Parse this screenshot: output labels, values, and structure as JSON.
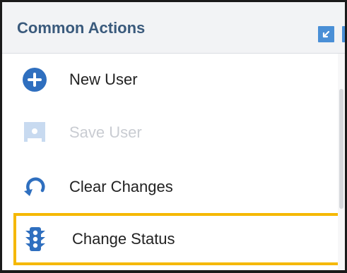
{
  "panel": {
    "title": "Common Actions",
    "header_buttons": [
      {
        "icon": "collapse-icon"
      },
      {
        "icon": "expand-icon"
      }
    ]
  },
  "actions": [
    {
      "label": "New User",
      "icon": "plus-circle-icon",
      "enabled": true
    },
    {
      "label": "Save User",
      "icon": "save-icon",
      "enabled": false
    },
    {
      "label": "Clear Changes",
      "icon": "undo-icon",
      "enabled": true
    },
    {
      "label": "Change Status",
      "icon": "traffic-light-icon",
      "enabled": true,
      "highlighted": true
    }
  ],
  "colors": {
    "title": "#3a5a7c",
    "icon_blue": "#2f6fbf",
    "icon_disabled": "#c8daf0",
    "highlight": "#f5b800",
    "header_bg": "#f2f3f5"
  }
}
